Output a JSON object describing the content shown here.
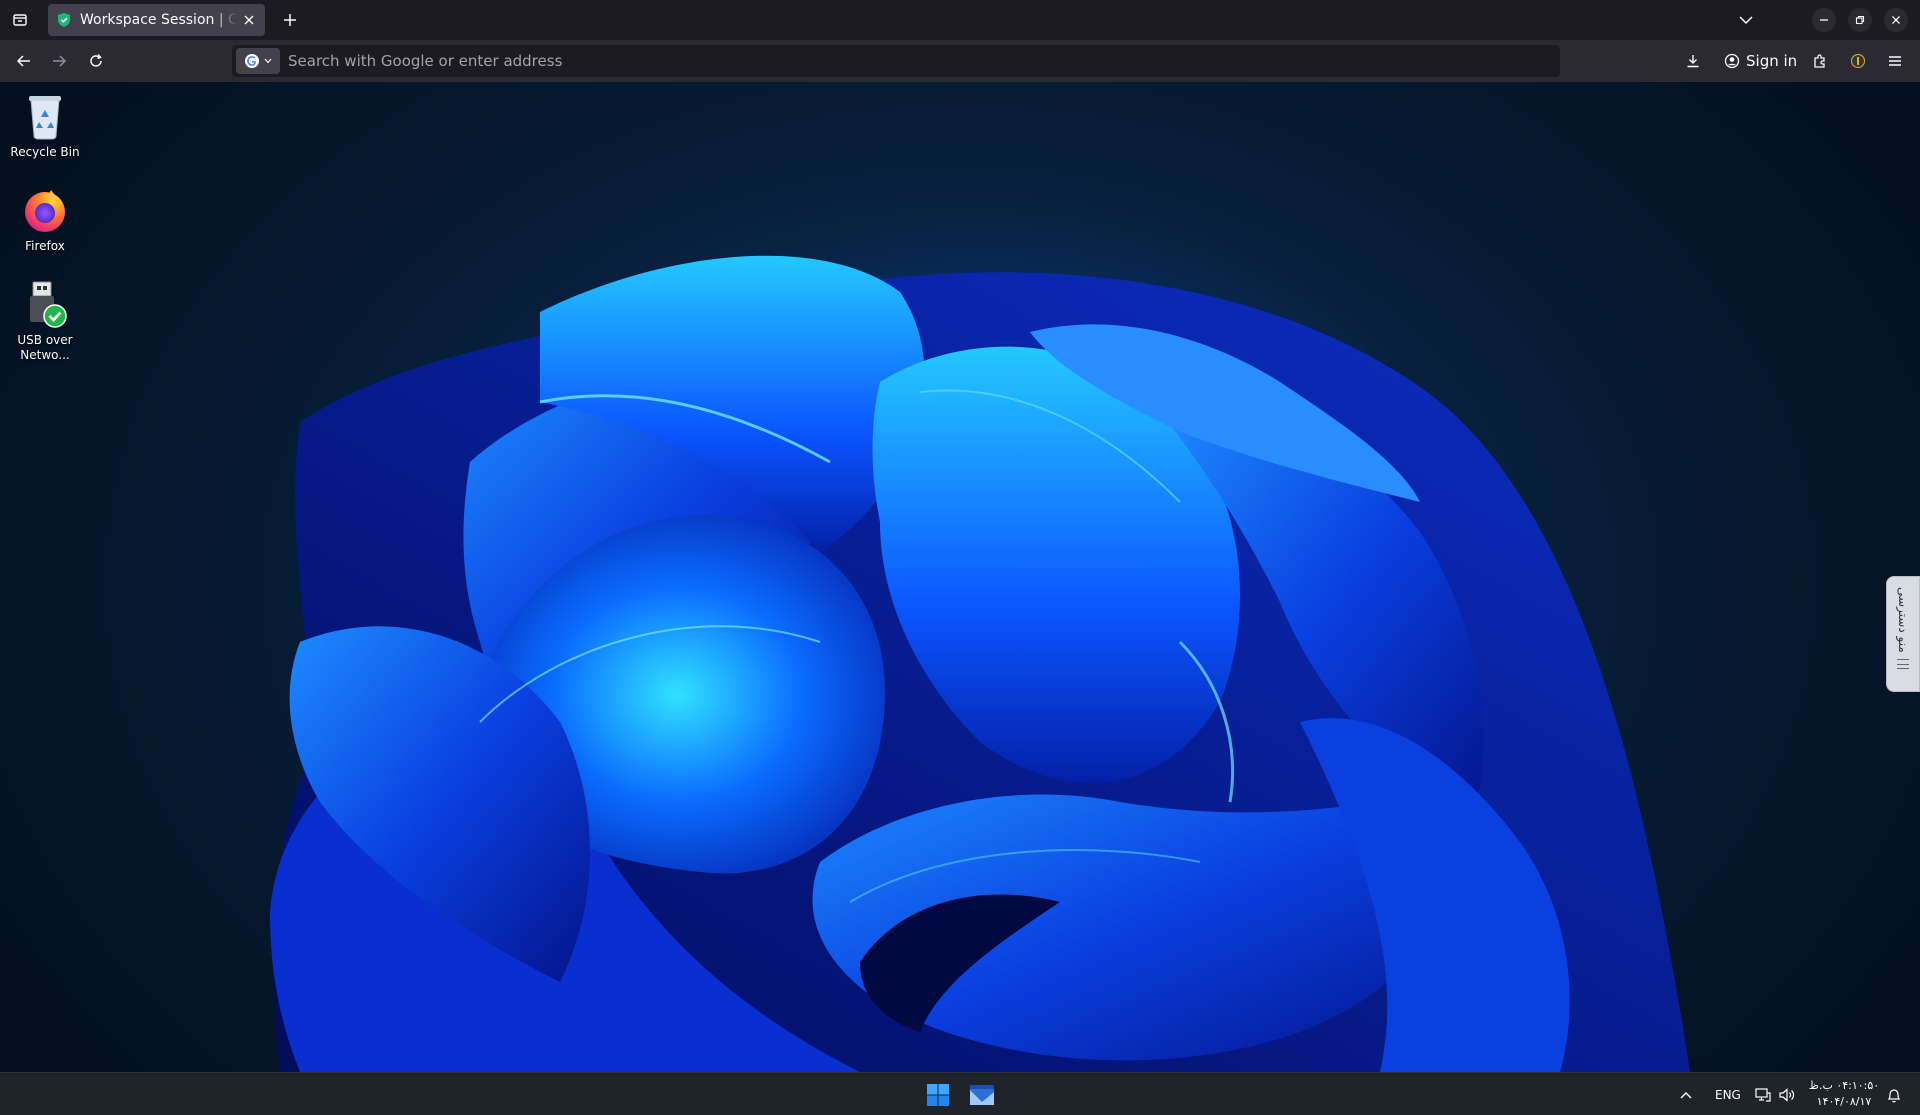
{
  "browser": {
    "tab": {
      "title": "Workspace Session | Cyb"
    },
    "urlbar": {
      "placeholder": "Search with Google or enter address"
    },
    "signin_label": "Sign in"
  },
  "desktop": {
    "icons": [
      {
        "label": "Recycle Bin",
        "icon": "recycle-bin-icon"
      },
      {
        "label": "Firefox",
        "icon": "firefox-icon"
      },
      {
        "label": "USB over\nNetwo...",
        "icon": "usb-network-icon"
      }
    ],
    "side_panel_label": "منو دسترسی"
  },
  "taskbar": {
    "language": "ENG",
    "time": "۰۴:۱۰:۵۰ ب.ظ",
    "date": "۱۴۰۴/۰۸/۱۷"
  },
  "colors": {
    "chrome_dark": "#1c1b22",
    "chrome_mid": "#2b2a33",
    "tab_active": "#42414d",
    "taskbar": "#1f232a",
    "accent_blue": "#0a57ff"
  }
}
